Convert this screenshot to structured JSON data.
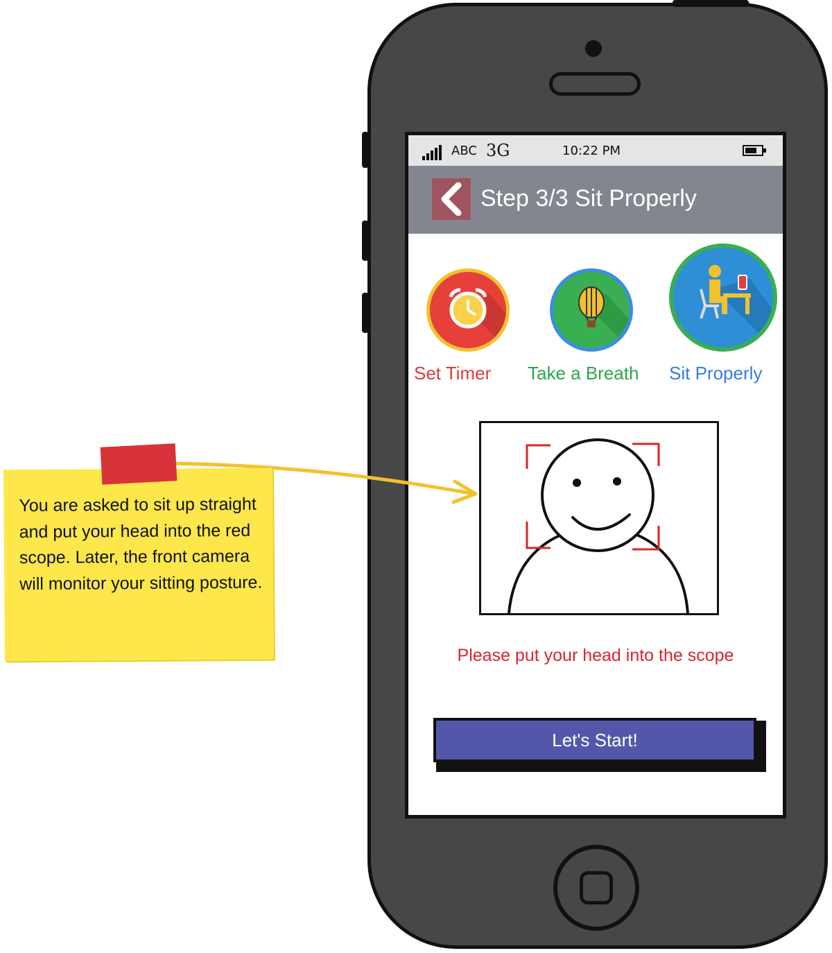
{
  "status_bar": {
    "carrier": "ABC",
    "network": "3G",
    "time": "10:22 PM"
  },
  "app_bar": {
    "title": "Step 3/3 Sit Properly"
  },
  "steps": [
    {
      "label": "Set Timer",
      "icon": "alarm-clock-icon",
      "color": "#e03a3a"
    },
    {
      "label": "Take a Breath",
      "icon": "hot-air-balloon-icon",
      "color": "#2aa84a"
    },
    {
      "label": "Sit Properly",
      "icon": "person-sitting-icon",
      "color": "#3a7be0"
    }
  ],
  "camera_scope": {
    "icon": "smiley-face-icon",
    "scope_color": "#d8262e"
  },
  "instruction": "Please put your head into the scope",
  "start_button": {
    "label": "Let's Start!",
    "color": "#5457a9"
  },
  "annotation": {
    "text": "You are asked to sit up straight and put your head into the red scope. Later, the front camera will monitor your sitting posture.",
    "color": "#fde74b"
  }
}
